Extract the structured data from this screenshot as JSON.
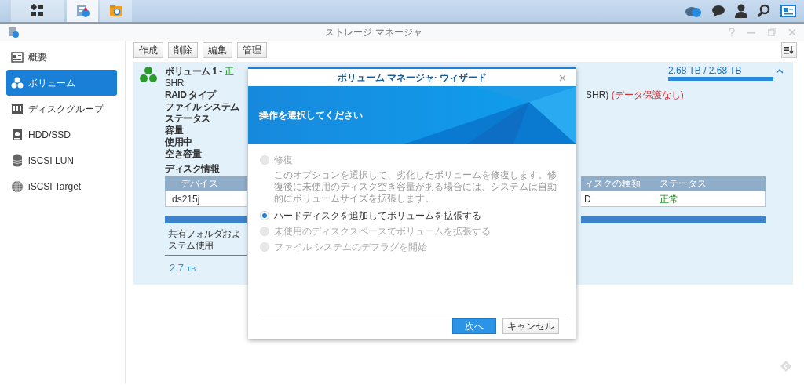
{
  "taskbar": {
    "apps": [
      {
        "selected": false
      },
      {
        "selected": true
      },
      {
        "selected": false
      }
    ]
  },
  "window": {
    "title": "ストレージ マネージャ"
  },
  "sidebar": {
    "items": [
      {
        "label": "概要",
        "selected": false
      },
      {
        "label": "ボリューム",
        "selected": true
      },
      {
        "label": "ディスクグループ",
        "selected": false
      },
      {
        "label": "HDD/SSD",
        "selected": false
      },
      {
        "label": "iSCSI LUN",
        "selected": false
      },
      {
        "label": "iSCSI Target",
        "selected": false
      }
    ]
  },
  "toolbar": {
    "buttons": [
      "作成",
      "削除",
      "編集",
      "管理"
    ]
  },
  "volume": {
    "title": "ボリューム 1 - ",
    "status": "正",
    "type": "SHR",
    "capacity": "2.68 TB / 2.68 TB",
    "level": 1,
    "labels": [
      "RAID タイプ",
      "ファイル システム",
      "ステータス",
      "容量",
      "使用中",
      "空き容量"
    ],
    "raid_value": "SHR)",
    "raid_note": "(データ保護なし)",
    "disk_info_title": "ディスク情報",
    "disk_table": {
      "columns": [
        "デバイス",
        "ィスクの種類",
        "ステータス"
      ],
      "rows": [
        [
          "ds215j",
          "D",
          "正常"
        ]
      ]
    },
    "usage_label": [
      "共有フォルダおよ",
      "ステム使用"
    ],
    "usage_value": "2.7",
    "usage_unit": "TB"
  },
  "dialog": {
    "title": "ボリューム マネージャ· ウィザード",
    "heading": "操作を選択してください",
    "options": [
      {
        "label": "修復",
        "selected": false,
        "disabled": true,
        "description": "このオプションを選択して、劣化したボリュームを修復します。修復後に未使用のディスク空き容量がある場合には、システムは自動的にボリュームサイズを拡張します。"
      },
      {
        "label": "ハードディスクを追加してボリュームを拡張する",
        "selected": true,
        "disabled": false
      },
      {
        "label": "未使用のディスクスペースでボリュームを拡張する",
        "selected": false,
        "disabled": true
      },
      {
        "label": "ファイル システムのデフラグを開始",
        "selected": false,
        "disabled": true
      }
    ],
    "buttons": [
      {
        "label": "次へ",
        "kind": "primary"
      },
      {
        "label": "キャンセル",
        "kind": "secondary"
      }
    ]
  }
}
